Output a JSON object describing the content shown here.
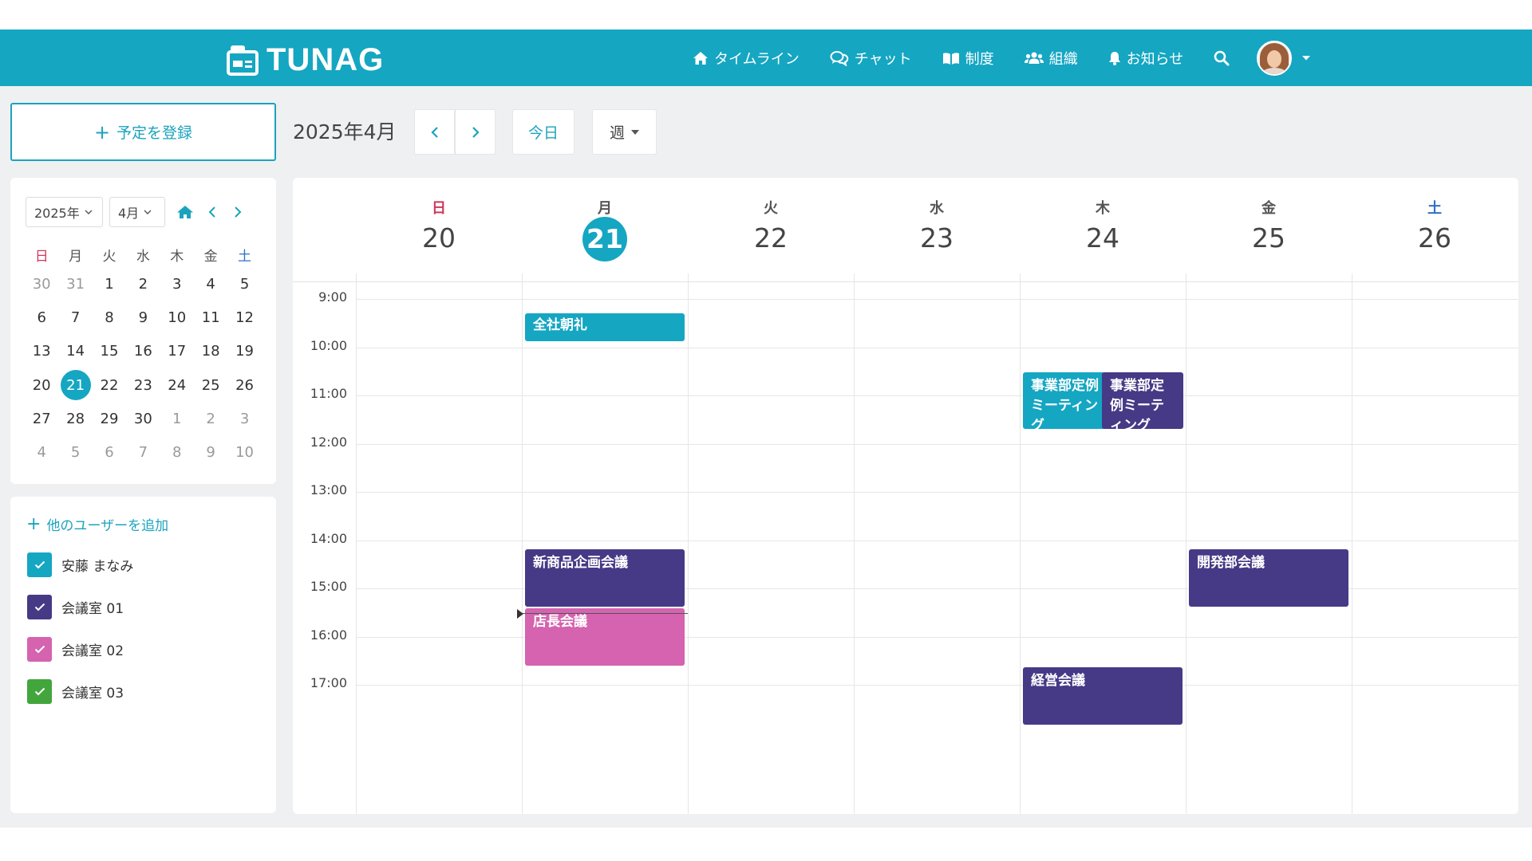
{
  "brand": {
    "name": "TUNAG"
  },
  "nav": {
    "items": [
      {
        "label": "タイムライン",
        "icon": "home-icon"
      },
      {
        "label": "チャット",
        "icon": "chat-icon"
      },
      {
        "label": "制度",
        "icon": "book-icon"
      },
      {
        "label": "組織",
        "icon": "users-icon"
      },
      {
        "label": "お知らせ",
        "icon": "bell-icon"
      }
    ],
    "search_icon": "search-icon",
    "account_caret": "caret-down-icon"
  },
  "toolbar": {
    "add_event_label": "予定を登録",
    "month_title": "2025年4月",
    "today_label": "今日",
    "view_label": "週"
  },
  "mini_calendar": {
    "year_select": "2025年",
    "month_select": "4月",
    "weekdays": [
      "日",
      "月",
      "火",
      "水",
      "木",
      "金",
      "土"
    ],
    "days": [
      "30",
      "31",
      "1",
      "2",
      "3",
      "4",
      "5",
      "6",
      "7",
      "8",
      "9",
      "10",
      "11",
      "12",
      "13",
      "14",
      "15",
      "16",
      "17",
      "18",
      "19",
      "20",
      "21",
      "22",
      "23",
      "24",
      "25",
      "26",
      "27",
      "28",
      "29",
      "30",
      "1",
      "2",
      "3",
      "4",
      "5",
      "6",
      "7",
      "8",
      "9",
      "10"
    ],
    "selected_day": "21"
  },
  "calendars": {
    "add_user_label": "他のユーザーを追加",
    "items": [
      {
        "label": "安藤 まなみ",
        "color": "#15a6c2"
      },
      {
        "label": "会議室 01",
        "color": "#463a86"
      },
      {
        "label": "会議室 02",
        "color": "#d563b0"
      },
      {
        "label": "会議室 03",
        "color": "#43a63d"
      }
    ]
  },
  "week": {
    "days": [
      {
        "name": "日",
        "num": "20"
      },
      {
        "name": "月",
        "num": "21"
      },
      {
        "name": "火",
        "num": "22"
      },
      {
        "name": "水",
        "num": "23"
      },
      {
        "name": "木",
        "num": "24"
      },
      {
        "name": "金",
        "num": "25"
      },
      {
        "name": "土",
        "num": "26"
      }
    ],
    "times": [
      "9:00",
      "10:00",
      "11:00",
      "12:00",
      "13:00",
      "14:00",
      "15:00",
      "16:00",
      "17:00"
    ],
    "events": [
      {
        "title": "全社朝礼",
        "color": "teal"
      },
      {
        "title": "事業部定例ミーティング",
        "color": "teal"
      },
      {
        "title": "事業部定例ミーティング",
        "color": "purple"
      },
      {
        "title": "新商品企画会議",
        "color": "purple"
      },
      {
        "title": "店長会議",
        "color": "pink"
      },
      {
        "title": "開発部会議",
        "color": "purple"
      },
      {
        "title": "経営会議",
        "color": "purple"
      }
    ]
  }
}
